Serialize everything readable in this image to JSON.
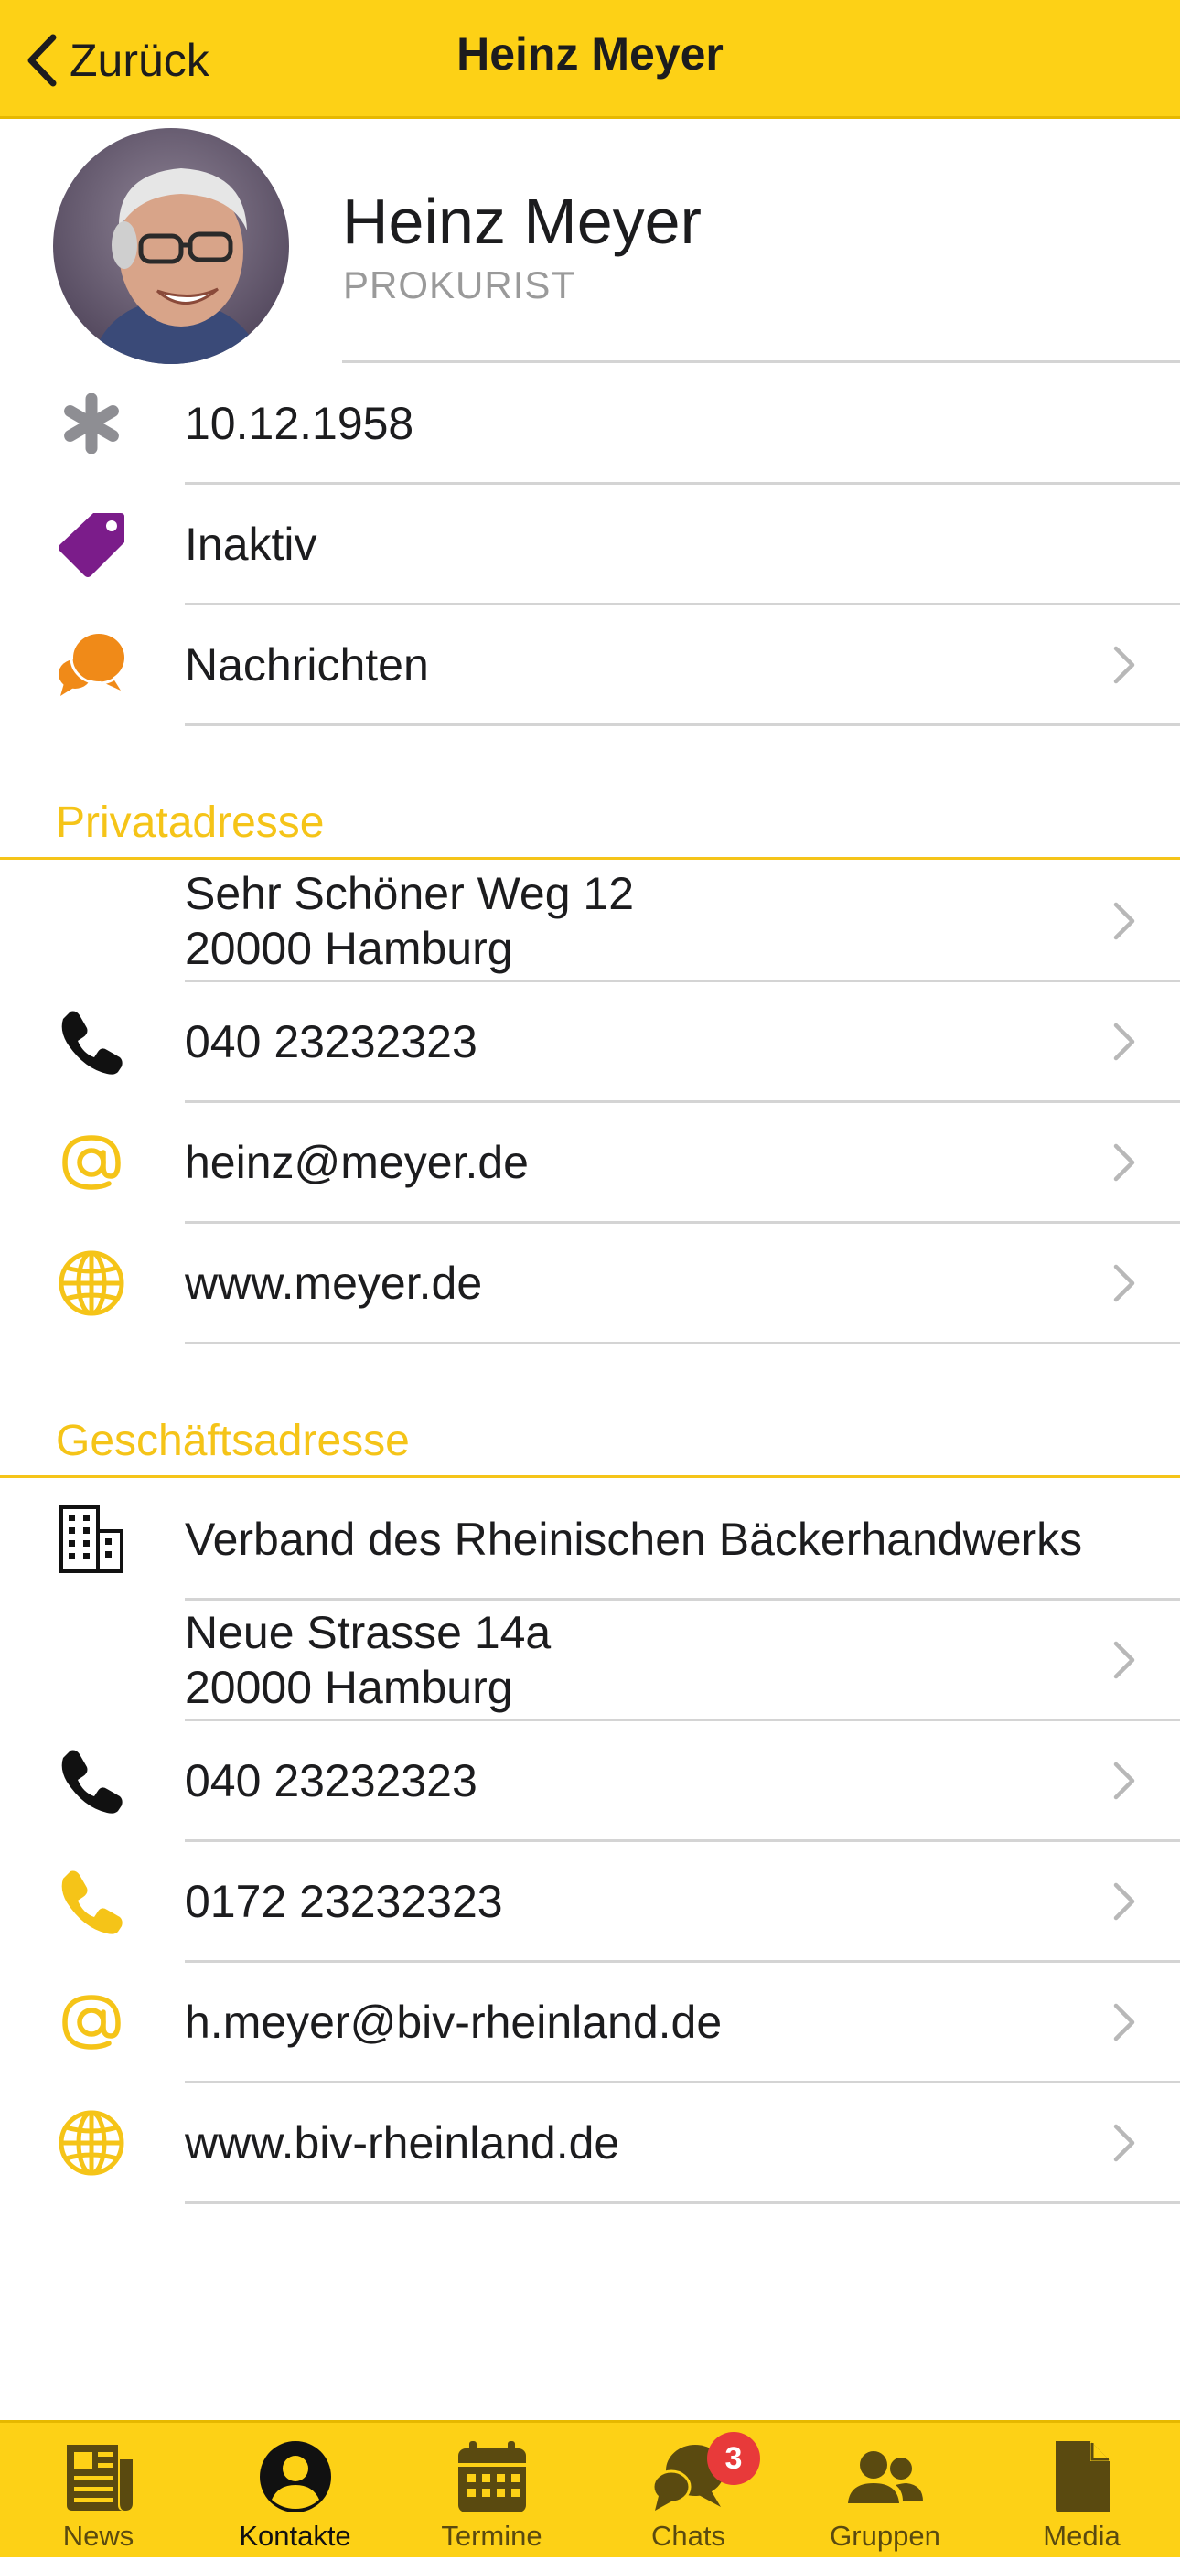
{
  "navbar": {
    "back_label": "Zurück",
    "title": "Heinz Meyer"
  },
  "profile": {
    "name": "Heinz Meyer",
    "role": "PROKURIST"
  },
  "info_rows": [
    {
      "icon": "asterisk-icon",
      "text": "10.12.1958",
      "link": false
    },
    {
      "icon": "tag-icon",
      "text": "Inaktiv",
      "link": false
    },
    {
      "icon": "chat-bubbles-icon",
      "text": "Nachrichten",
      "link": true
    }
  ],
  "private": {
    "header": "Privatadresse",
    "rows": [
      {
        "icon": "none",
        "lines": [
          "Sehr Schöner Weg 12",
          "20000 Hamburg"
        ],
        "link": true
      },
      {
        "icon": "phone-icon",
        "lines": [
          "040 23232323"
        ],
        "link": true
      },
      {
        "icon": "at-icon",
        "lines": [
          "heinz@meyer.de"
        ],
        "link": true
      },
      {
        "icon": "globe-icon",
        "lines": [
          "www.meyer.de"
        ],
        "link": true
      }
    ]
  },
  "business": {
    "header": "Geschäftsadresse",
    "rows": [
      {
        "icon": "building-icon",
        "lines": [
          "Verband des Rheinischen Bäckerhandwerks"
        ],
        "link": false
      },
      {
        "icon": "none",
        "lines": [
          "Neue Strasse 14a",
          "20000 Hamburg"
        ],
        "link": true
      },
      {
        "icon": "phone-icon",
        "lines": [
          "040 23232323"
        ],
        "link": true
      },
      {
        "icon": "mobile-phone-icon",
        "lines": [
          "0172 23232323"
        ],
        "link": true
      },
      {
        "icon": "at-icon",
        "lines": [
          "h.meyer@biv-rheinland.de"
        ],
        "link": true
      },
      {
        "icon": "globe-icon",
        "lines": [
          "www.biv-rheinland.de"
        ],
        "link": true
      }
    ]
  },
  "tabbar": {
    "tabs": [
      {
        "label": "News",
        "icon": "newspaper-icon",
        "active": false
      },
      {
        "label": "Kontakte",
        "icon": "person-circle-icon",
        "active": true
      },
      {
        "label": "Termine",
        "icon": "calendar-icon",
        "active": false
      },
      {
        "label": "Chats",
        "icon": "chat-bubbles-icon",
        "active": false,
        "badge": "3"
      },
      {
        "label": "Gruppen",
        "icon": "group-icon",
        "active": false
      },
      {
        "label": "Media",
        "icon": "document-icon",
        "active": false
      }
    ]
  },
  "colors": {
    "accent": "#fdd116",
    "section_header": "#f5c418",
    "tag_purple": "#7b1c8a",
    "chat_orange": "#f08a18",
    "icon_gray": "#8e8e93",
    "badge_red": "#e83a3a",
    "tab_icon": "#5a4a10"
  }
}
